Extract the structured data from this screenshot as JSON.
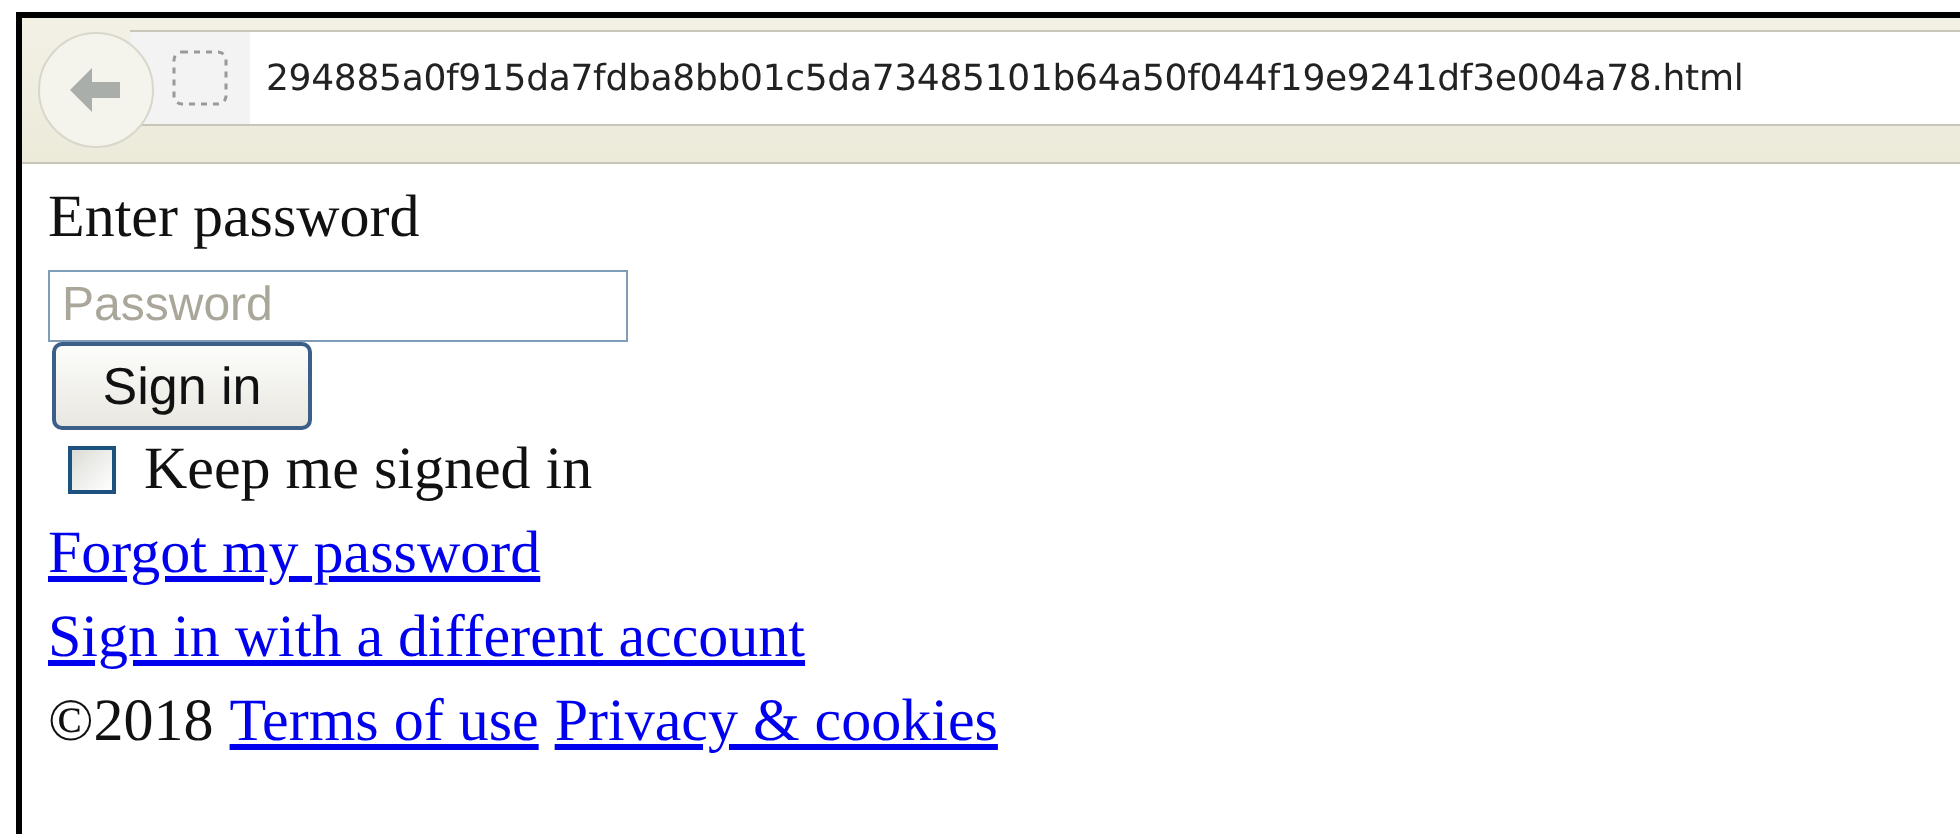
{
  "browser": {
    "address": "294885a0f915da7fdba8bb01c5da73485101b64a50f044f19e9241df3e004a78.html"
  },
  "form": {
    "label": "Enter password",
    "password_field": {
      "placeholder": "Password"
    },
    "button": "Sign in",
    "keep_signed_in": {
      "label": "Keep me signed in",
      "checked": false
    },
    "links": [
      "Forgot my password",
      "Sign in with a different account"
    ],
    "footer": {
      "copyright": "©2018",
      "links": [
        "Terms of use",
        "Privacy & cookies"
      ]
    }
  }
}
